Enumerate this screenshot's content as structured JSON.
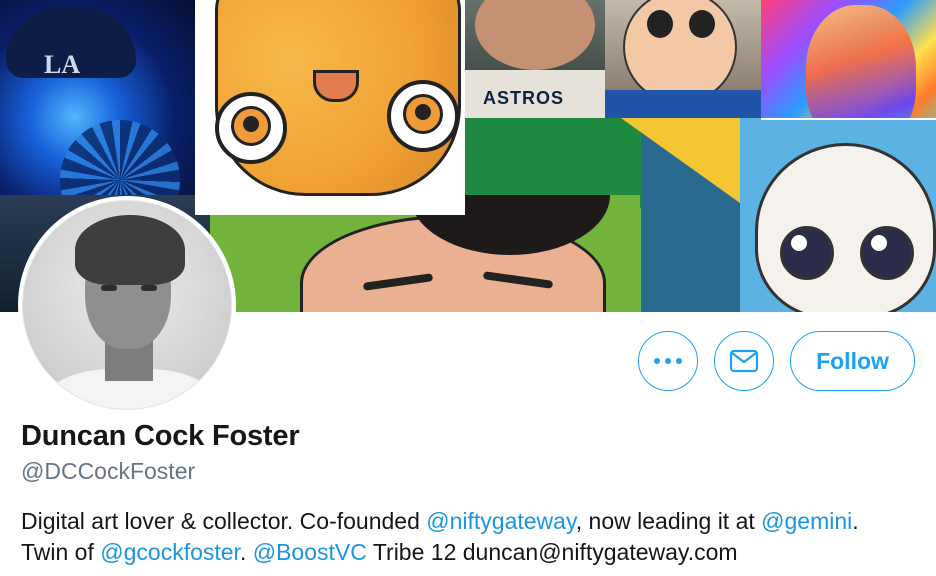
{
  "profile": {
    "name": "Duncan Cock Foster",
    "handle": "@DCCockFoster",
    "bio": {
      "line1": {
        "text_a": "Digital art lover & collector. Co-founded ",
        "mention_a": "@niftygateway",
        "text_b": ", now leading it at ",
        "mention_b": "@gemini",
        "text_c": "."
      },
      "line2": {
        "text_a": "Twin of ",
        "mention_a": "@gcockfoster",
        "text_b": ". ",
        "mention_b": "@BoostVC",
        "text_c": " Tribe 12 duncan@niftygateway.com"
      }
    }
  },
  "actions": {
    "more_icon": "more-dots-icon",
    "message_icon": "envelope-icon",
    "follow_label": "Follow"
  },
  "banner": {
    "cap_logo": "LA",
    "jersey_text": "ASTROS"
  },
  "colors": {
    "accent": "#1da1f2",
    "mention": "#1b95e0",
    "name": "#14171a",
    "secondary": "#657786"
  }
}
